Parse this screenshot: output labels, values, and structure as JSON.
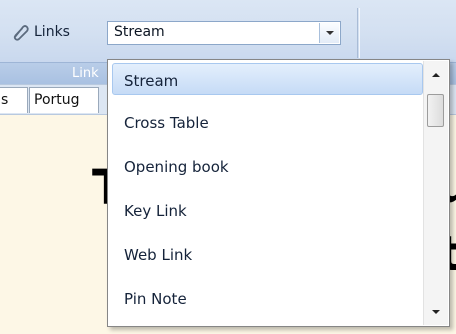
{
  "ribbon": {
    "links_label": "Links",
    "links_icon": "paperclip-icon",
    "group_caption": "Link"
  },
  "combo": {
    "value": "Stream"
  },
  "tabs": [
    {
      "label": "s"
    },
    {
      "label": "Portug"
    }
  ],
  "document": {
    "fragment_1": "T",
    "fragment_2": "u",
    "fragment_3": "t"
  },
  "dropdown": {
    "selected_index": 0,
    "items": [
      {
        "label": "Stream"
      },
      {
        "label": "Cross Table"
      },
      {
        "label": "Opening book"
      },
      {
        "label": "Key Link"
      },
      {
        "label": "Web Link"
      },
      {
        "label": "Pin Note"
      }
    ]
  },
  "colors": {
    "ribbon_bg": "#d3e0f1",
    "selection": "#c6dbf6",
    "document_bg": "#fdf7e6"
  }
}
